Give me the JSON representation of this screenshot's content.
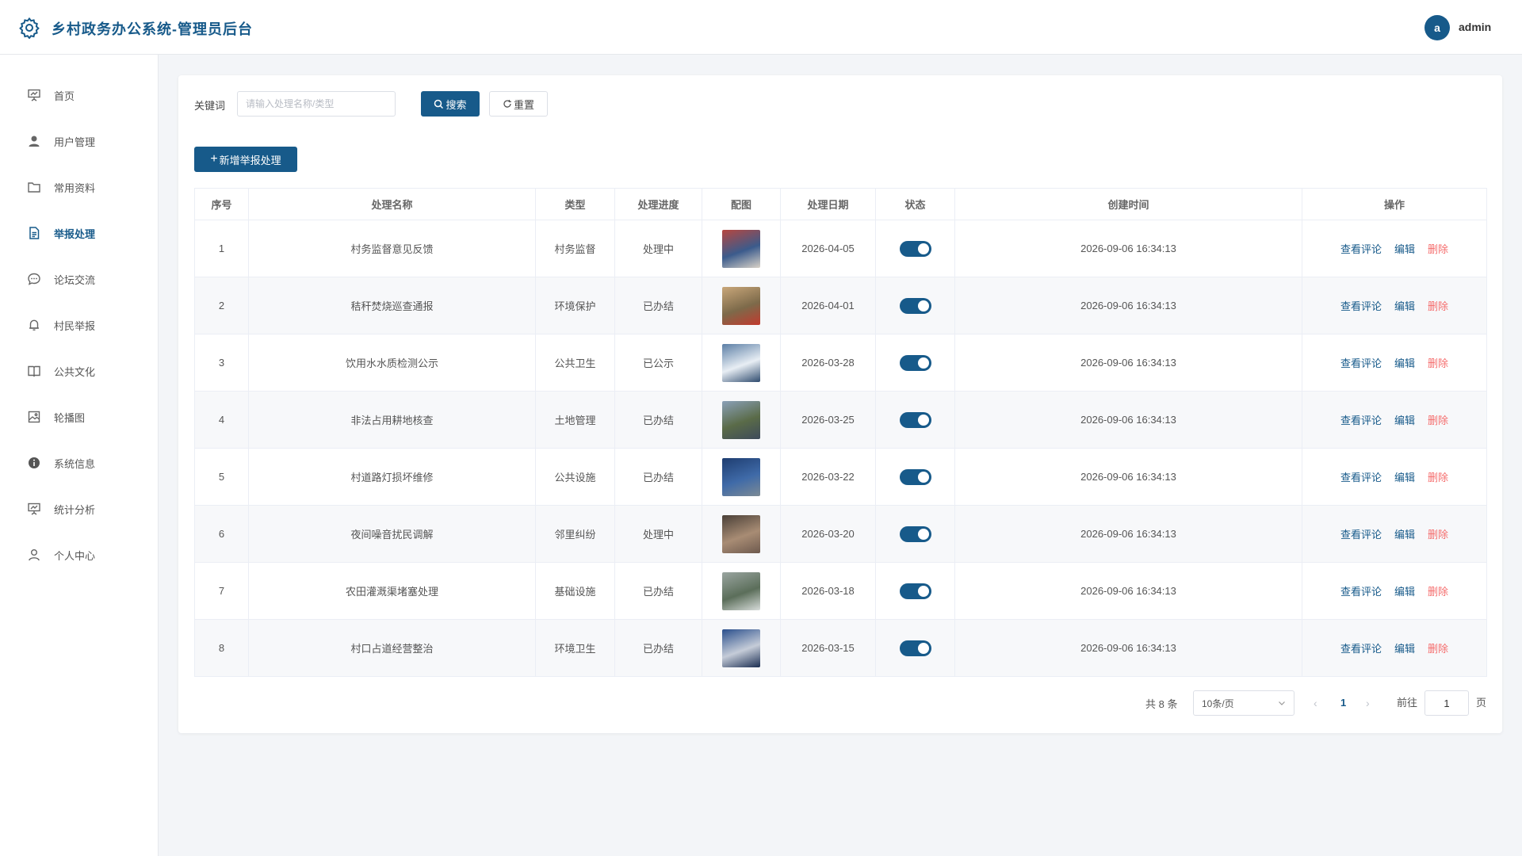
{
  "header": {
    "title": "乡村政务办公系统-管理员后台",
    "avatar_letter": "a",
    "username": "admin"
  },
  "sidebar": {
    "items": [
      {
        "label": "首页",
        "icon": "presentation-icon"
      },
      {
        "label": "用户管理",
        "icon": "user-icon"
      },
      {
        "label": "常用资料",
        "icon": "folder-icon"
      },
      {
        "label": "举报处理",
        "icon": "document-icon",
        "active": true
      },
      {
        "label": "论坛交流",
        "icon": "chat-icon"
      },
      {
        "label": "村民举报",
        "icon": "bell-icon"
      },
      {
        "label": "公共文化",
        "icon": "book-icon"
      },
      {
        "label": "轮播图",
        "icon": "picture-icon"
      },
      {
        "label": "系统信息",
        "icon": "info-icon"
      },
      {
        "label": "统计分析",
        "icon": "presentation-icon"
      },
      {
        "label": "个人中心",
        "icon": "user-outline-icon"
      }
    ]
  },
  "search": {
    "label": "关键词",
    "placeholder": "请输入处理名称/类型",
    "search_button": "搜索",
    "reset_button": "重置"
  },
  "add_button": "新增举报处理",
  "table": {
    "columns": [
      "序号",
      "处理名称",
      "类型",
      "处理进度",
      "配图",
      "处理日期",
      "状态",
      "创建时间",
      "操作"
    ],
    "actions": {
      "view": "查看评论",
      "edit": "编辑",
      "delete": "删除"
    },
    "rows": [
      {
        "no": "1",
        "name": "村务监督意见反馈",
        "type": "村务监督",
        "progress": "处理中",
        "date": "2026-04-05",
        "created": "2026-09-06 16:34:13",
        "thumb": [
          "#b7463f",
          "#3b5b8c",
          "#d9d2c8"
        ]
      },
      {
        "no": "2",
        "name": "秸秆焚烧巡查通报",
        "type": "环境保护",
        "progress": "已办结",
        "date": "2026-04-01",
        "created": "2026-09-06 16:34:13",
        "thumb": [
          "#c9a77a",
          "#7d6a4a",
          "#c23a2e"
        ]
      },
      {
        "no": "3",
        "name": "饮用水水质检测公示",
        "type": "公共卫生",
        "progress": "已公示",
        "date": "2026-03-28",
        "created": "2026-09-06 16:34:13",
        "thumb": [
          "#5c7fa6",
          "#e8eef4",
          "#2f4b6e"
        ]
      },
      {
        "no": "4",
        "name": "非法占用耕地核查",
        "type": "土地管理",
        "progress": "已办结",
        "date": "2026-03-25",
        "created": "2026-09-06 16:34:13",
        "thumb": [
          "#8aa0b8",
          "#5a6b48",
          "#3d4a5a"
        ]
      },
      {
        "no": "5",
        "name": "村道路灯损坏维修",
        "type": "公共设施",
        "progress": "已办结",
        "date": "2026-03-22",
        "created": "2026-09-06 16:34:13",
        "thumb": [
          "#1e3d70",
          "#3f6aa8",
          "#7c8a95"
        ]
      },
      {
        "no": "6",
        "name": "夜间噪音扰民调解",
        "type": "邻里纠纷",
        "progress": "处理中",
        "date": "2026-03-20",
        "created": "2026-09-06 16:34:13",
        "thumb": [
          "#4a4038",
          "#a88c74",
          "#6e5a4e"
        ]
      },
      {
        "no": "7",
        "name": "农田灌溉渠堵塞处理",
        "type": "基础设施",
        "progress": "已办结",
        "date": "2026-03-18",
        "created": "2026-09-06 16:34:13",
        "thumb": [
          "#9aa5a0",
          "#5b6e5a",
          "#d7dcda"
        ]
      },
      {
        "no": "8",
        "name": "村口占道经营整治",
        "type": "环境卫生",
        "progress": "已办结",
        "date": "2026-03-15",
        "created": "2026-09-06 16:34:13",
        "thumb": [
          "#2a4f8c",
          "#c5ccd8",
          "#1b2e52"
        ]
      }
    ]
  },
  "pagination": {
    "total_text": "共 8 条",
    "page_size": "10条/页",
    "current_page": "1",
    "goto_label": "前往",
    "goto_value": "1",
    "page_unit": "页"
  }
}
